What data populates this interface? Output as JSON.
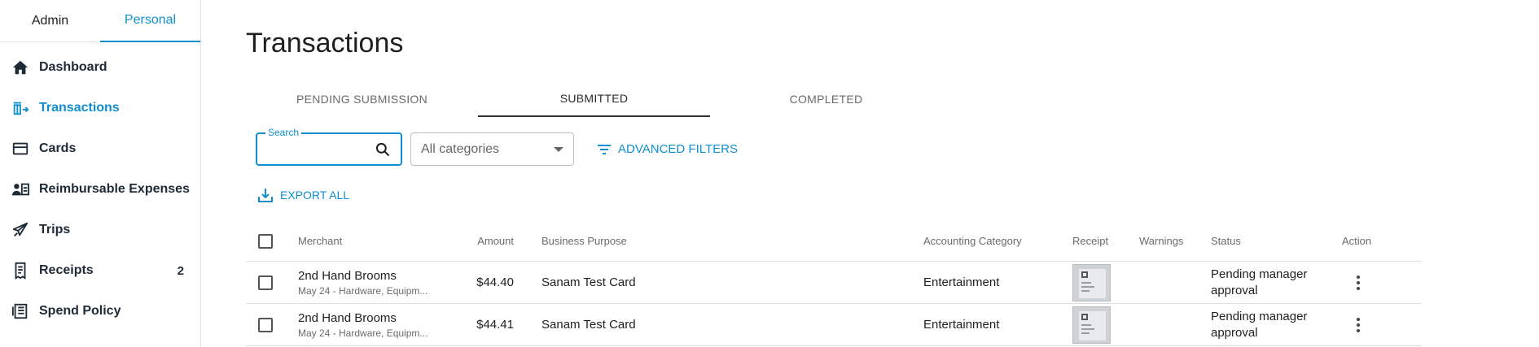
{
  "sidebar": {
    "mode_tabs": [
      {
        "label": "Admin",
        "active": false
      },
      {
        "label": "Personal",
        "active": true
      }
    ],
    "items": [
      {
        "label": "Dashboard",
        "icon": "home-icon",
        "active": false
      },
      {
        "label": "Transactions",
        "icon": "transactions-icon",
        "active": true
      },
      {
        "label": "Cards",
        "icon": "card-icon",
        "active": false
      },
      {
        "label": "Reimbursable Expenses",
        "icon": "reimbursement-icon",
        "active": false
      },
      {
        "label": "Trips",
        "icon": "plane-icon",
        "active": false
      },
      {
        "label": "Receipts",
        "icon": "receipt-icon",
        "active": false,
        "badge": "2"
      },
      {
        "label": "Spend Policy",
        "icon": "policy-icon",
        "active": false
      }
    ]
  },
  "page": {
    "title": "Transactions",
    "tabs": [
      {
        "label": "PENDING SUBMISSION",
        "active": false
      },
      {
        "label": "SUBMITTED",
        "active": true
      },
      {
        "label": "COMPLETED",
        "active": false
      }
    ]
  },
  "filters": {
    "search_label": "Search",
    "search_value": "",
    "category_selected": "All categories",
    "advanced_filters_label": "ADVANCED FILTERS"
  },
  "export_all_label": "EXPORT ALL",
  "table": {
    "headers": {
      "merchant": "Merchant",
      "amount": "Amount",
      "purpose": "Business Purpose",
      "category": "Accounting Category",
      "receipt": "Receipt",
      "warnings": "Warnings",
      "status": "Status",
      "action": "Action"
    },
    "rows": [
      {
        "merchant": "2nd Hand Brooms",
        "sub": "May 24 - Hardware, Equipm...",
        "amount": "$44.40",
        "purpose": "Sanam Test Card",
        "category": "Entertainment",
        "warnings": "",
        "status": "Pending manager approval"
      },
      {
        "merchant": "2nd Hand Brooms",
        "sub": "May 24 - Hardware, Equipm...",
        "amount": "$44.41",
        "purpose": "Sanam Test Card",
        "category": "Entertainment",
        "warnings": "",
        "status": "Pending manager approval"
      }
    ]
  },
  "colors": {
    "accent": "#0f8fcf",
    "text": "#1f1f1f",
    "muted": "#6b6b6b"
  }
}
